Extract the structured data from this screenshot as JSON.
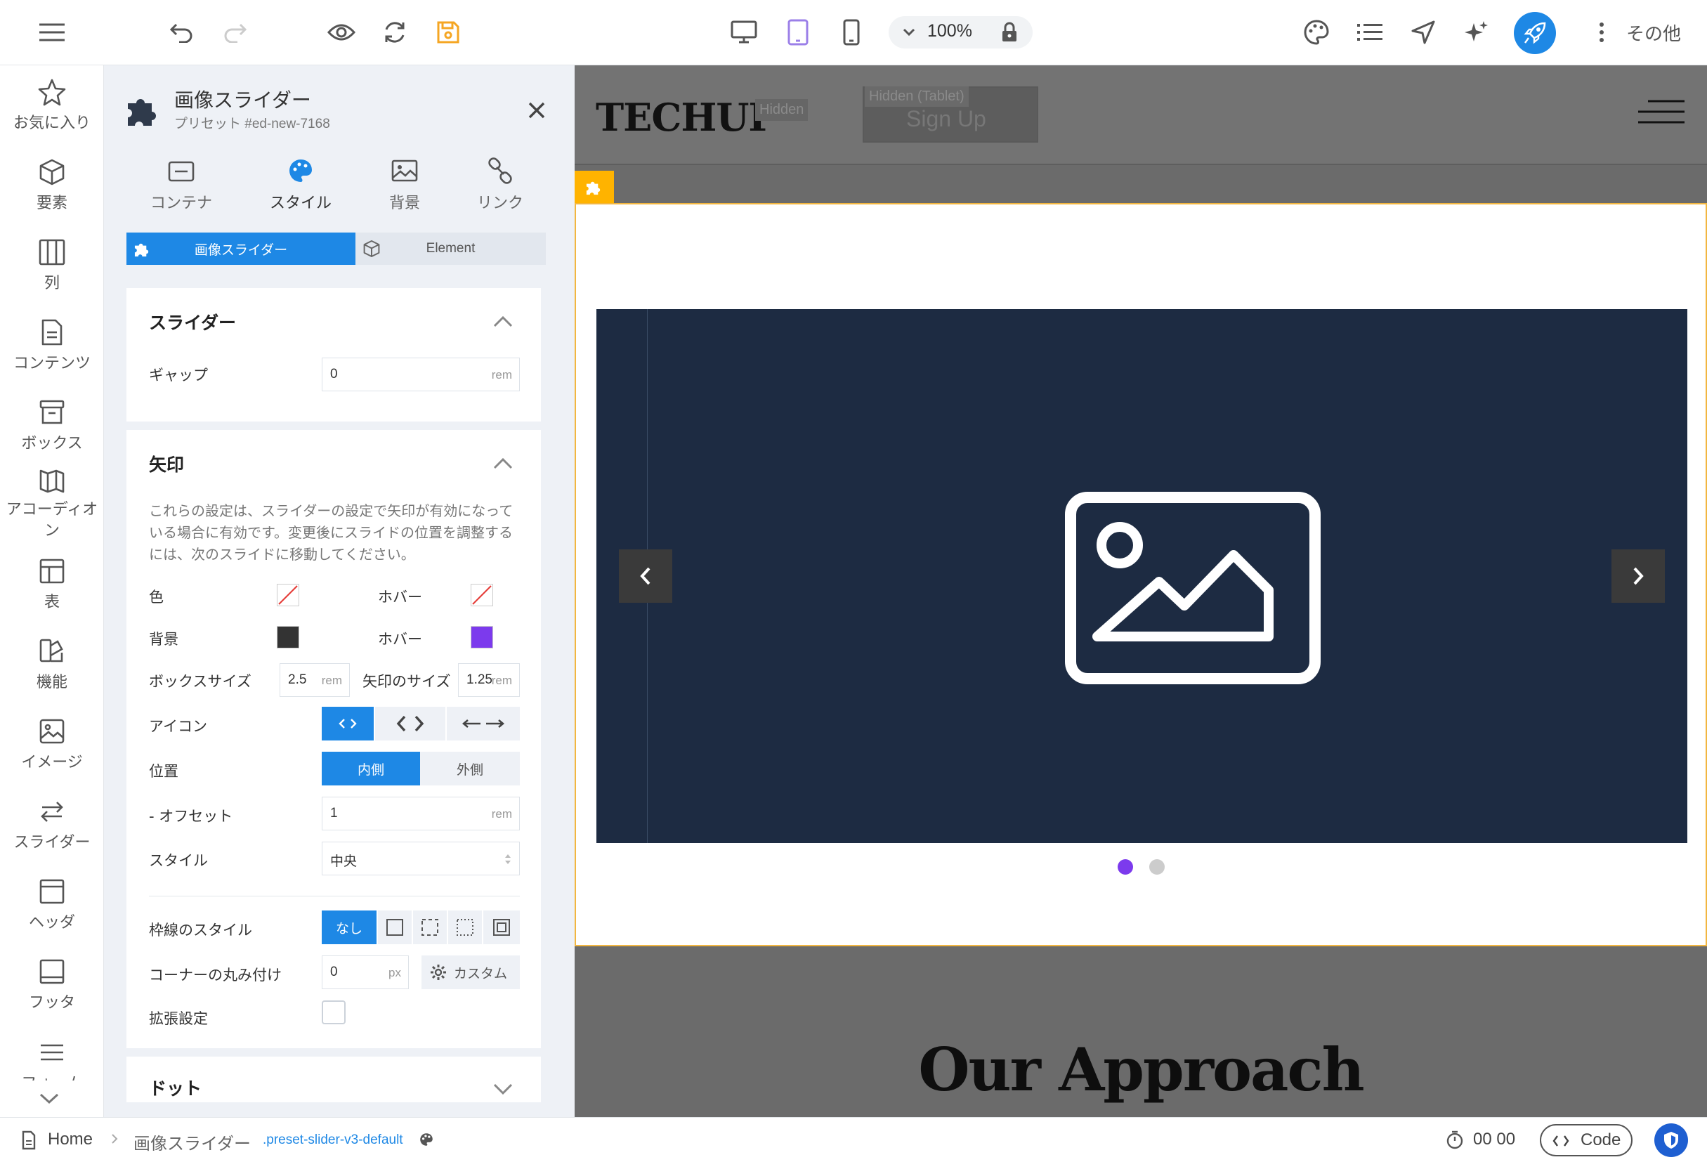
{
  "topbar": {
    "zoom": "100%",
    "more_label": "その他"
  },
  "leftbar": {
    "items": [
      {
        "label": "お気に入り",
        "icon": "star-icon"
      },
      {
        "label": "要素",
        "icon": "cube-icon"
      },
      {
        "label": "列",
        "icon": "columns-icon"
      },
      {
        "label": "コンテンツ",
        "icon": "document-icon"
      },
      {
        "label": "ボックス",
        "icon": "archive-icon"
      },
      {
        "label": "アコーディオン",
        "icon": "accordion-icon"
      },
      {
        "label": "表",
        "icon": "table-icon"
      },
      {
        "label": "機能",
        "icon": "features-icon"
      },
      {
        "label": "イメージ",
        "icon": "image-icon"
      },
      {
        "label": "スライダー",
        "icon": "slider-icon"
      },
      {
        "label": "ヘッダ",
        "icon": "header-icon"
      },
      {
        "label": "フッタ",
        "icon": "footer-icon"
      },
      {
        "label": "フォーム",
        "icon": "form-icon"
      }
    ]
  },
  "panel": {
    "title": "画像スライダー",
    "subtitle": "プリセット #ed-new-7168",
    "tabs": [
      {
        "label": "コンテナ",
        "icon": "container-icon"
      },
      {
        "label": "スタイル",
        "icon": "palette-icon"
      },
      {
        "label": "背景",
        "icon": "background-image-icon"
      },
      {
        "label": "リンク",
        "icon": "link-icon"
      }
    ],
    "subtabs": {
      "active": "画像スライダー",
      "other": "Element"
    },
    "slider_section": {
      "title": "スライダー",
      "gap_label": "ギャップ",
      "gap_value": "0",
      "gap_unit": "rem"
    },
    "arrows_section": {
      "title": "矢印",
      "description": "これらの設定は、スライダーの設定で矢印が有効になっている場合に有効です。変更後にスライドの位置を調整するには、次のスライドに移動してください。",
      "color_label": "色",
      "hover_label": "ホバー",
      "bg_label": "背景",
      "bg_hover_label": "ホバー",
      "bg_color": "#333333",
      "bg_hover_color": "#7c3aed",
      "box_size_label": "ボックスサイズ",
      "box_size_value": "2.5",
      "box_size_unit": "rem",
      "arrow_size_label": "矢印のサイズ",
      "arrow_size_value": "1.25",
      "arrow_size_unit": "rem",
      "icon_label": "アイコン",
      "position_label": "位置",
      "position_inside": "内側",
      "position_outside": "外側",
      "offset_label": "- オフセット",
      "offset_value": "1",
      "offset_unit": "rem",
      "style_label": "スタイル",
      "style_value": "中央",
      "border_label": "枠線のスタイル",
      "border_none": "なし",
      "corner_label": "コーナーの丸み付け",
      "corner_value": "0",
      "corner_unit": "px",
      "custom_label": "カスタム",
      "advanced_label": "拡張設定"
    },
    "dots_section": {
      "title": "ドット"
    }
  },
  "canvas": {
    "logo": "TECHUP",
    "hidden_tag": "Hidden",
    "hidden_tablet_tag": "Hidden (Tablet)",
    "signup": "Sign Up",
    "heading": "Our Approach",
    "dot_active_color": "#7c3aed",
    "dot_inactive_color": "#cccccc"
  },
  "statusbar": {
    "home": "Home",
    "element": "画像スライダー",
    "preset_class": ".preset-slider-v3-default",
    "timer": "00 00",
    "code": "Code"
  }
}
